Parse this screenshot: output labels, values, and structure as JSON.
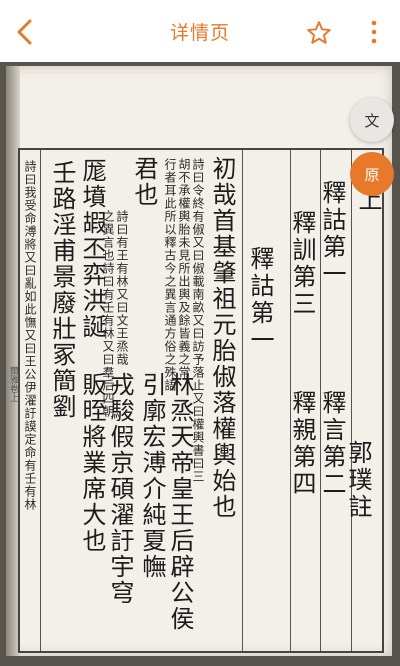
{
  "header": {
    "title": "详情页",
    "back_icon": "chevron-left-icon",
    "favorite_icon": "star-outline-icon",
    "more_icon": "vertical-ellipsis-icon",
    "accent_color": "#e8782a"
  },
  "actions": {
    "text_mode_label": "文",
    "original_mode_label": "原"
  },
  "book": {
    "volume": "卷上",
    "author": "郭璞註",
    "chapters": [
      {
        "heading": "釋詁第一",
        "sub": "釋言第二"
      },
      {
        "heading": "釋訓第三",
        "sub": "釋親第四"
      }
    ],
    "section_title": "釋詁第一",
    "main_line_1": "初哉首基肇祖元胎俶落權輿始也",
    "main_line_2": "林烝天帝皇王后辟公侯",
    "main_line_3": "引廓宏溥介純夏幠",
    "main_line_4": "君也",
    "main_line_5": "戎駿假京碩濯訏宇穹",
    "main_line_6": "厖墳嘏丕弈洪誕",
    "main_line_7": "販晊將業席大也",
    "main_line_8": "壬路淫甫景廢壯冢簡劉",
    "note_1": "詩曰令終有俶又曰俶載南畝又曰訪予落止又曰權輿書曰三",
    "note_2": "胡不承權輿胎未見所出輿及餘皆義之常",
    "note_3": "行者耳此所以釋古今之異言通方俗之殊語",
    "note_4": "詩曰有王有林又曰文王烝哉",
    "note_5": "之異言也詩曰有壬有林又曰羣后四朝",
    "note_6": "詩曰我受命溥將又曰亂如此憮又曰王公伊濯訏謨定命有壬有林",
    "margin_text": "爾雅卷上"
  }
}
